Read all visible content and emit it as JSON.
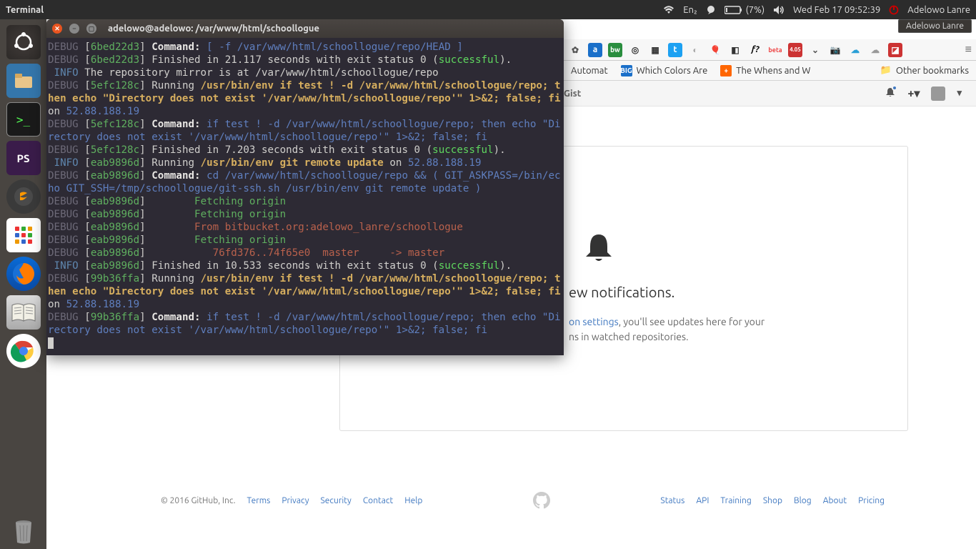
{
  "top_panel": {
    "app_name": "Terminal",
    "wifi_icon": "wifi-icon",
    "lang": "En₂",
    "battery": "(7%)",
    "datetime": "Wed Feb 17 09:52:39",
    "user": "Adelowo Lanre"
  },
  "launcher": {
    "items": [
      "ubuntu-dash",
      "files",
      "terminal",
      "phpstorm",
      "sublime",
      "apps-grid",
      "firefox",
      "dictionary",
      "chrome",
      "trash"
    ]
  },
  "terminal": {
    "title": "adelowo@adelowo: /var/www/html/schoollogue",
    "lines": [
      {
        "parts": [
          {
            "t": "DEBUG",
            "c": "c-dim"
          },
          {
            "t": " [",
            "c": "c-white"
          },
          {
            "t": "6bed22d3",
            "c": "c-green"
          },
          {
            "t": "] ",
            "c": "c-white"
          },
          {
            "t": "Command:",
            "c": "c-bwhite"
          },
          {
            "t": " ",
            "c": "c-white"
          },
          {
            "t": "[ -f /var/www/html/schoollogue/repo/HEAD ]",
            "c": "c-blue2"
          }
        ]
      },
      {
        "parts": [
          {
            "t": "DEBUG",
            "c": "c-dim"
          },
          {
            "t": " [",
            "c": "c-white"
          },
          {
            "t": "6bed22d3",
            "c": "c-green"
          },
          {
            "t": "] Finished in 21.117 seconds with exit status 0 (",
            "c": "c-white"
          },
          {
            "t": "successful",
            "c": "c-greenb"
          },
          {
            "t": ").",
            "c": "c-white"
          }
        ]
      },
      {
        "parts": [
          {
            "t": " INFO",
            "c": "c-cyan"
          },
          {
            "t": " The repository mirror is at /var/www/html/schoollogue/repo",
            "c": "c-white"
          }
        ]
      },
      {
        "parts": [
          {
            "t": "DEBUG",
            "c": "c-dim"
          },
          {
            "t": " [",
            "c": "c-white"
          },
          {
            "t": "5efc128c",
            "c": "c-green"
          },
          {
            "t": "] Running ",
            "c": "c-white"
          },
          {
            "t": "/usr/bin/env if test ! -d /var/www/html/schoollogue/repo; then echo \"Directory does not exist '/var/www/html/schoollogue/repo'\" 1>&2; false; fi",
            "c": "c-yellow"
          },
          {
            "t": " on ",
            "c": "c-white"
          },
          {
            "t": "52.88.188.19",
            "c": "c-blue2"
          }
        ]
      },
      {
        "parts": [
          {
            "t": "DEBUG",
            "c": "c-dim"
          },
          {
            "t": " [",
            "c": "c-white"
          },
          {
            "t": "5efc128c",
            "c": "c-green"
          },
          {
            "t": "] ",
            "c": "c-white"
          },
          {
            "t": "Command:",
            "c": "c-bwhite"
          },
          {
            "t": " ",
            "c": "c-white"
          },
          {
            "t": "if test ! -d /var/www/html/schoollogue/repo; then echo \"Directory does not exist '/var/www/html/schoollogue/repo'\" 1>&2; false; fi",
            "c": "c-blue2"
          }
        ]
      },
      {
        "parts": [
          {
            "t": "DEBUG",
            "c": "c-dim"
          },
          {
            "t": " [",
            "c": "c-white"
          },
          {
            "t": "5efc128c",
            "c": "c-green"
          },
          {
            "t": "] Finished in 7.203 seconds with exit status 0 (",
            "c": "c-white"
          },
          {
            "t": "successful",
            "c": "c-greenb"
          },
          {
            "t": ").",
            "c": "c-white"
          }
        ]
      },
      {
        "parts": [
          {
            "t": " INFO",
            "c": "c-cyan"
          },
          {
            "t": " [",
            "c": "c-white"
          },
          {
            "t": "eab9896d",
            "c": "c-green"
          },
          {
            "t": "] Running ",
            "c": "c-white"
          },
          {
            "t": "/usr/bin/env git remote update",
            "c": "c-yellow"
          },
          {
            "t": " on ",
            "c": "c-white"
          },
          {
            "t": "52.88.188.19",
            "c": "c-blue2"
          }
        ]
      },
      {
        "parts": [
          {
            "t": "DEBUG",
            "c": "c-dim"
          },
          {
            "t": " [",
            "c": "c-white"
          },
          {
            "t": "eab9896d",
            "c": "c-green"
          },
          {
            "t": "] ",
            "c": "c-white"
          },
          {
            "t": "Command:",
            "c": "c-bwhite"
          },
          {
            "t": " ",
            "c": "c-white"
          },
          {
            "t": "cd /var/www/html/schoollogue/repo && ( GIT_ASKPASS=/bin/echo GIT_SSH=/tmp/schoollogue/git-ssh.sh /usr/bin/env git remote update )",
            "c": "c-blue2"
          }
        ]
      },
      {
        "parts": [
          {
            "t": "DEBUG",
            "c": "c-dim"
          },
          {
            "t": " [",
            "c": "c-white"
          },
          {
            "t": "eab9896d",
            "c": "c-green"
          },
          {
            "t": "] ",
            "c": "c-white"
          },
          {
            "t": "       Fetching origin",
            "c": "c-green"
          }
        ]
      },
      {
        "parts": [
          {
            "t": "DEBUG",
            "c": "c-dim"
          },
          {
            "t": " [",
            "c": "c-white"
          },
          {
            "t": "eab9896d",
            "c": "c-green"
          },
          {
            "t": "] ",
            "c": "c-white"
          },
          {
            "t": "       Fetching origin",
            "c": "c-green"
          }
        ]
      },
      {
        "parts": [
          {
            "t": "DEBUG",
            "c": "c-dim"
          },
          {
            "t": " [",
            "c": "c-white"
          },
          {
            "t": "eab9896d",
            "c": "c-green"
          },
          {
            "t": "] ",
            "c": "c-white"
          },
          {
            "t": "       From bitbucket.org:adelowo_lanre/schoollogue",
            "c": "c-red"
          }
        ]
      },
      {
        "parts": [
          {
            "t": "DEBUG",
            "c": "c-dim"
          },
          {
            "t": " [",
            "c": "c-white"
          },
          {
            "t": "eab9896d",
            "c": "c-green"
          },
          {
            "t": "] ",
            "c": "c-white"
          },
          {
            "t": "       Fetching origin",
            "c": "c-green"
          }
        ]
      },
      {
        "parts": [
          {
            "t": "DEBUG",
            "c": "c-dim"
          },
          {
            "t": " [",
            "c": "c-white"
          },
          {
            "t": "eab9896d",
            "c": "c-green"
          },
          {
            "t": "] ",
            "c": "c-white"
          },
          {
            "t": "          76fd376..74f65e0  master     -> master",
            "c": "c-red"
          }
        ]
      },
      {
        "parts": [
          {
            "t": " INFO",
            "c": "c-cyan"
          },
          {
            "t": " [",
            "c": "c-white"
          },
          {
            "t": "eab9896d",
            "c": "c-green"
          },
          {
            "t": "] Finished in 10.533 seconds with exit status 0 (",
            "c": "c-white"
          },
          {
            "t": "successful",
            "c": "c-greenb"
          },
          {
            "t": ").",
            "c": "c-white"
          }
        ]
      },
      {
        "parts": [
          {
            "t": "DEBUG",
            "c": "c-dim"
          },
          {
            "t": " [",
            "c": "c-white"
          },
          {
            "t": "99b36ffa",
            "c": "c-green"
          },
          {
            "t": "] Running ",
            "c": "c-white"
          },
          {
            "t": "/usr/bin/env if test ! -d /var/www/html/schoollogue/repo; then echo \"Directory does not exist '/var/www/html/schoollogue/repo'\" 1>&2; false; fi",
            "c": "c-yellow"
          },
          {
            "t": " on ",
            "c": "c-white"
          },
          {
            "t": "52.88.188.19",
            "c": "c-blue2"
          }
        ]
      },
      {
        "parts": [
          {
            "t": "DEBUG",
            "c": "c-dim"
          },
          {
            "t": " [",
            "c": "c-white"
          },
          {
            "t": "99b36ffa",
            "c": "c-green"
          },
          {
            "t": "] ",
            "c": "c-white"
          },
          {
            "t": "Command:",
            "c": "c-bwhite"
          },
          {
            "t": " ",
            "c": "c-white"
          },
          {
            "t": "if test ! -d /var/www/html/schoollogue/repo; then echo \"Directory does not exist '/var/www/html/schoollogue/repo'\" 1>&2; false; fi",
            "c": "c-blue2"
          }
        ]
      }
    ]
  },
  "browser": {
    "bookmarks": [
      {
        "label": "Automat",
        "icon": "#eee",
        "fg": "#333"
      },
      {
        "label": "Which Colors Are",
        "icon": "#1a6fc9",
        "fg": "#fff",
        "txt": "BIG"
      },
      {
        "label": "The Whens and W",
        "icon": "#ff6600",
        "fg": "#fff",
        "txt": "+"
      }
    ],
    "other_bookmarks": "Other bookmarks"
  },
  "github": {
    "nav": {
      "gist": "Gist"
    },
    "heading_tail": "ew notifications.",
    "body_link_tail": "on settings",
    "body_line1_tail": ", you'll see updates here for your",
    "body_line2_tail": "ns in watched repositories.",
    "footer": {
      "copy": "© 2016 GitHub, Inc.",
      "left": [
        "Terms",
        "Privacy",
        "Security",
        "Contact",
        "Help"
      ],
      "right": [
        "Status",
        "API",
        "Training",
        "Shop",
        "Blog",
        "About",
        "Pricing"
      ]
    }
  }
}
